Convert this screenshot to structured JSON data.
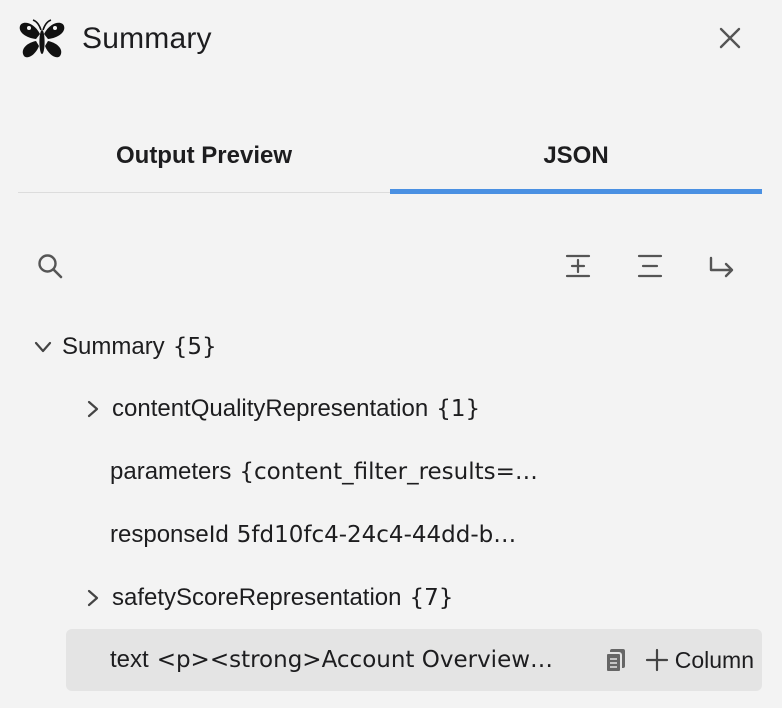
{
  "header": {
    "title": "Summary",
    "logo_icon": "butterfly-icon",
    "close_icon": "close-icon"
  },
  "tabs": [
    {
      "label": "Output Preview",
      "active": false
    },
    {
      "label": "JSON",
      "active": true
    }
  ],
  "toolbar": {
    "search_icon": "search-icon",
    "expand_all_icon": "expand-all-icon",
    "collapse_all_icon": "collapse-all-icon",
    "wrap_icon": "wrap-arrow-icon"
  },
  "tree": {
    "root": {
      "key": "Summary",
      "value": "{5}",
      "expanded": true
    },
    "children": [
      {
        "key": "contentQualityRepresentation",
        "value": "{1}",
        "expandable": true
      },
      {
        "key": "parameters",
        "value": "{content_filter_results=…",
        "expandable": false
      },
      {
        "key": "responseId",
        "value": "5fd10fc4-24c4-44dd-b…",
        "expandable": false
      },
      {
        "key": "safetyScoreRepresentation",
        "value": "{7}",
        "expandable": true
      },
      {
        "key": "text",
        "value": "<p><strong>Account Overview…",
        "expandable": false,
        "highlighted": true
      }
    ]
  },
  "row_actions": {
    "copy_icon": "copy-icon",
    "add_column_label": "Column"
  },
  "colors": {
    "accent": "#4a90e2",
    "background": "#f3f3f3",
    "highlight_row": "#e4e4e4"
  }
}
